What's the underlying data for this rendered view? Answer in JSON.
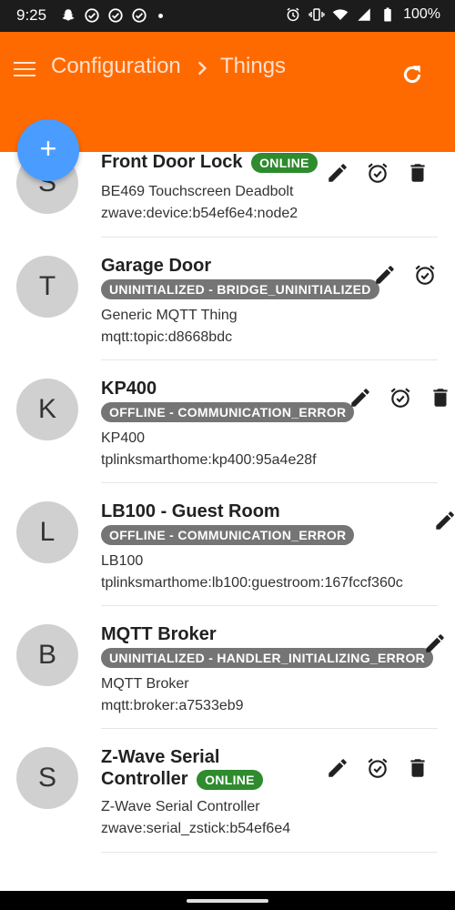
{
  "status_bar": {
    "time": "9:25",
    "left_icons": [
      "snapchat-icon",
      "check-circle-icon",
      "check-circle-icon",
      "check-circle-icon",
      "dot-icon"
    ],
    "right_icons": [
      "alarm-icon",
      "vibrate-icon",
      "wifi-icon",
      "signal-icon",
      "battery-icon"
    ],
    "battery": "100%"
  },
  "app_bar": {
    "color": "#ff6a00",
    "breadcrumb": [
      "Configuration",
      "Things"
    ],
    "icons": [
      "menu-icon",
      "chevron-right-icon",
      "refresh-icon"
    ]
  },
  "fab": {
    "label": "+",
    "color": "#4a9dff"
  },
  "things": [
    {
      "initial": "S",
      "title": "Front Door Lock",
      "status": "ONLINE",
      "status_color": "#2e8b2e",
      "description": "BE469 Touchscreen Deadbolt",
      "uid": "zwave:device:b54ef6e4:node2",
      "actions": [
        "edit-icon",
        "alarm-check-icon",
        "delete-icon"
      ]
    },
    {
      "initial": "T",
      "title": "Garage Door",
      "status": "UNINITIALIZED - BRIDGE_UNINITIALIZED",
      "status_color": "#757575",
      "description": "Generic MQTT Thing",
      "uid": "mqtt:topic:d8668bdc",
      "actions": [
        "edit-icon",
        "alarm-check-icon"
      ]
    },
    {
      "initial": "K",
      "title": "KP400",
      "status": "OFFLINE - COMMUNICATION_ERROR",
      "status_color": "#757575",
      "description": "KP400",
      "uid": "tplinksmarthome:kp400:95a4e28f",
      "actions": [
        "edit-icon",
        "alarm-check-icon",
        "delete-icon"
      ]
    },
    {
      "initial": "L",
      "title": "LB100 - Guest Room",
      "status": "OFFLINE - COMMUNICATION_ERROR",
      "status_color": "#757575",
      "description": "LB100",
      "uid": "tplinksmarthome:lb100:guestroom:167fccf360c",
      "actions": [
        "edit-icon"
      ]
    },
    {
      "initial": "B",
      "title": "MQTT Broker",
      "status": "UNINITIALIZED - HANDLER_INITIALIZING_ERROR",
      "status_color": "#757575",
      "description": "MQTT Broker",
      "uid": "mqtt:broker:a7533eb9",
      "actions": [
        "edit-icon"
      ]
    },
    {
      "initial": "S",
      "title_line1": "Z-Wave Serial",
      "title_line2": "Controller",
      "status": "ONLINE",
      "status_color": "#2e8b2e",
      "description": "Z-Wave Serial Controller",
      "uid": "zwave:serial_zstick:b54ef6e4",
      "actions": [
        "edit-icon",
        "alarm-check-icon",
        "delete-icon"
      ]
    }
  ]
}
